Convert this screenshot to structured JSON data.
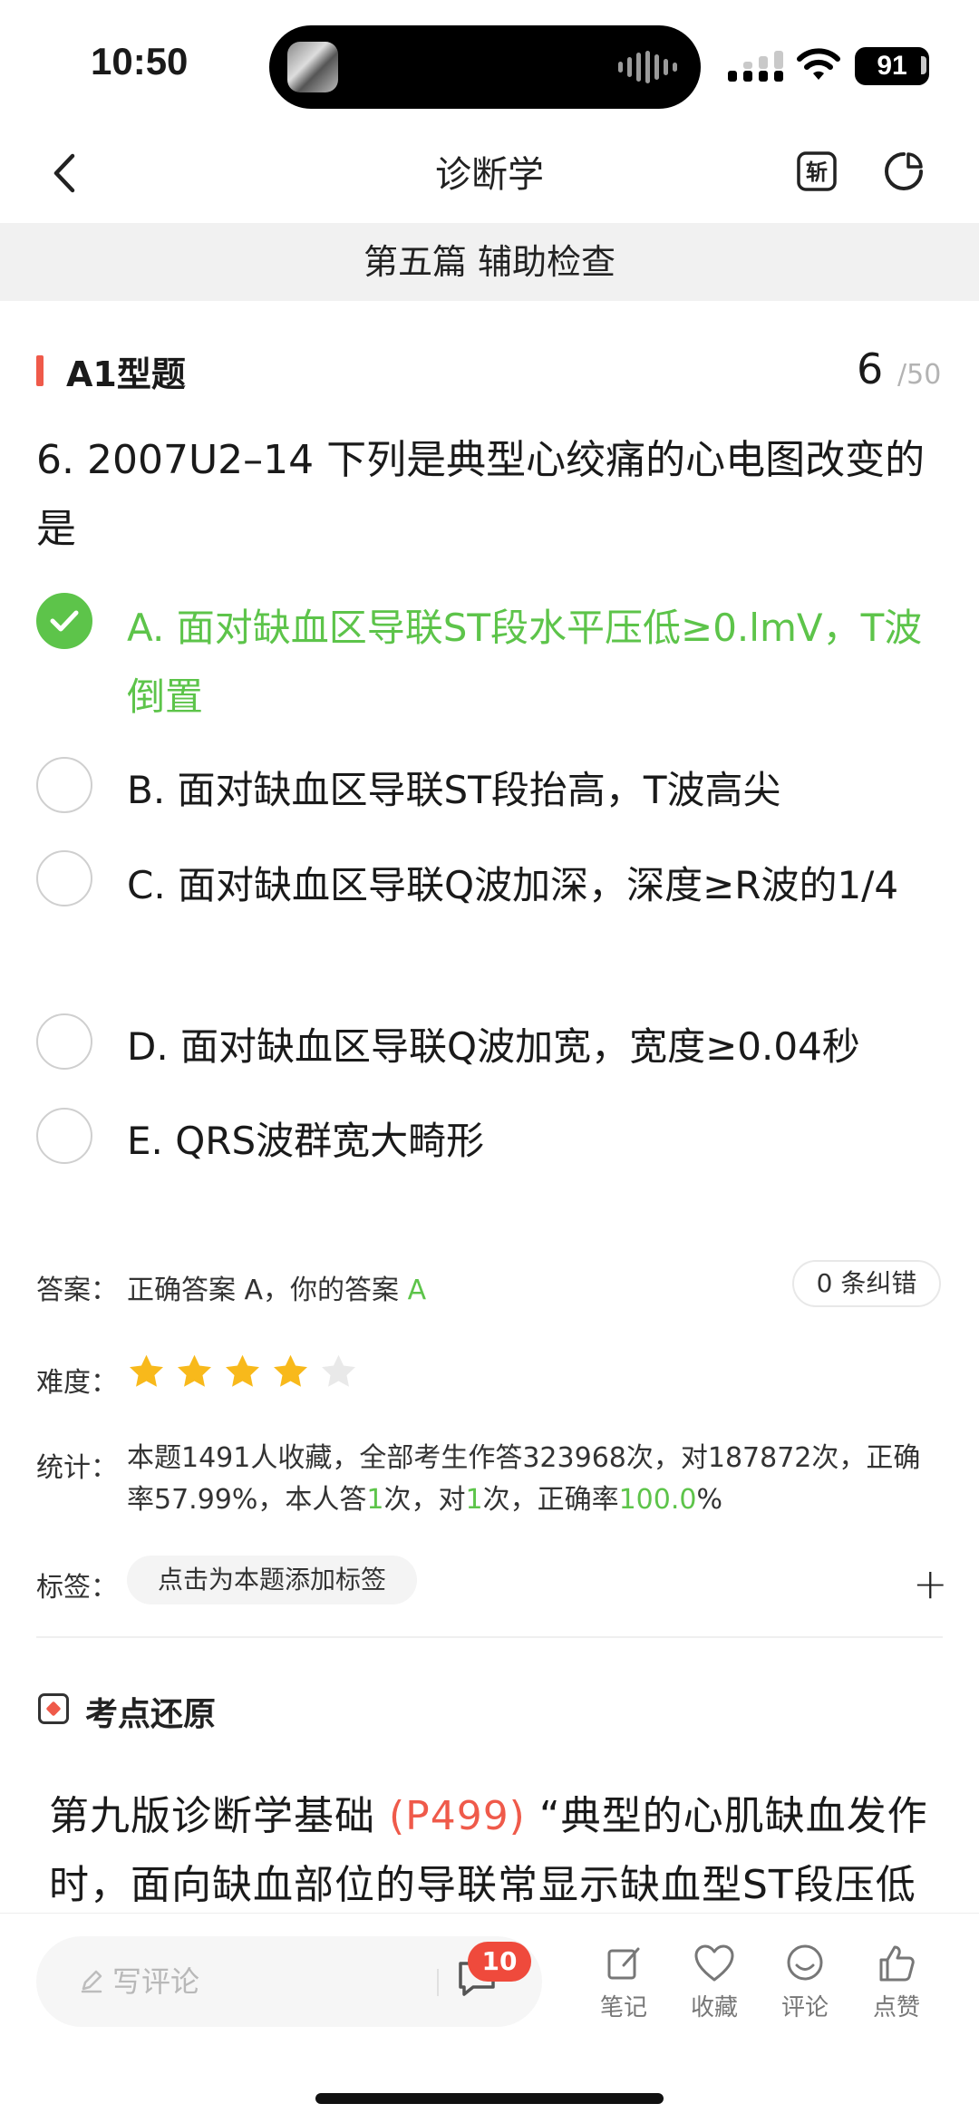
{
  "status_bar": {
    "time": "10:50",
    "battery": "91"
  },
  "nav": {
    "title": "诊断学"
  },
  "section": {
    "title": "第五篇 辅助检查"
  },
  "question": {
    "type": "A1型题",
    "current": "6",
    "total": "/50",
    "text": "6. 2007U2–14 下列是典型心绞痛的心电图改变的是",
    "options": [
      {
        "label": "A. 面对缺血区导联ST段水平压低≥0.lmV，T波倒置",
        "correct": true
      },
      {
        "label": "B. 面对缺血区导联ST段抬高，T波高尖"
      },
      {
        "label": "C. 面对缺血区导联Q波加深，深度≥R波的1/4"
      },
      {
        "label": "D. 面对缺血区导联Q波加宽，宽度≥0.04秒"
      },
      {
        "label": "E. QRS波群宽大畸形"
      }
    ]
  },
  "answer": {
    "label": "答案：",
    "text": "正确答案 A，你的答案 ",
    "your_answer": "A",
    "corrections": "0 条纠错"
  },
  "difficulty": {
    "label": "难度：",
    "rating": 4,
    "max": 5,
    "star_color": "#f8b91b",
    "empty_color": "#e9e9e9"
  },
  "stats": {
    "label": "统计：",
    "part1": "本题1491人收藏，全部考生作答323968次，对187872次，正确率57.99%，本人答",
    "answered": "1",
    "part2": "次，对",
    "correct_count": "1",
    "part3": "次，正确率",
    "rate": "100.0",
    "part4": "%"
  },
  "tags": {
    "label": "标签：",
    "add_tag": "点击为本题添加标签",
    "plus": "+"
  },
  "knowledge": {
    "title": "考点还原",
    "body_prefix": "第九版诊断学基础 ",
    "body_ref": "(P499)",
    "body_suffix": " “典型的心肌缺血发作时，面向缺血部位的导联常显示缺血型ST段压低"
  },
  "bottom_bar": {
    "comment_placeholder": "写评论",
    "comment_count": "10",
    "actions": [
      {
        "icon": "note-icon",
        "label": "笔记"
      },
      {
        "icon": "heart-icon",
        "label": "收藏"
      },
      {
        "icon": "smile-icon",
        "label": "评论"
      },
      {
        "icon": "thumb-up-icon",
        "label": "点赞"
      }
    ]
  },
  "colors": {
    "accent_green": "#5dc44a",
    "accent_red": "#ef5a4a"
  }
}
